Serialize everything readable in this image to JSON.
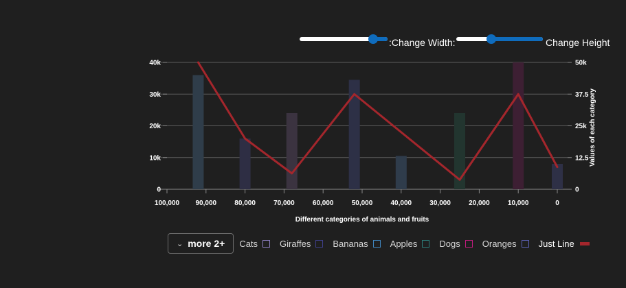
{
  "controls": {
    "width_label": ":Change Width:",
    "height_label": "Change Height"
  },
  "legend": {
    "overflow_label": "more 2+",
    "items": [
      {
        "label": "Cats",
        "color": "#8d7fc2"
      },
      {
        "label": "Giraffes",
        "color": "#3e3f8a"
      },
      {
        "label": "Bananas",
        "color": "#3f86bf"
      },
      {
        "label": "Apples",
        "color": "#2d7d7a"
      },
      {
        "label": "Dogs",
        "color": "#c01c7e"
      },
      {
        "label": "Oranges",
        "color": "#5c61b5"
      },
      {
        "label": "Just Line",
        "color": "#a4262c"
      }
    ]
  },
  "chart_data": {
    "type": "bar",
    "xlabel": "Different categories of animals and fruits",
    "ylabel": "",
    "y2label": "Values of each category",
    "x_reversed": true,
    "xlim": [
      0,
      100000
    ],
    "x_ticks": [
      "100,000",
      "90,000",
      "80,000",
      "70,000",
      "60,000",
      "50,000",
      "40,000",
      "30,000",
      "20,000",
      "10,000",
      "0"
    ],
    "ylim": [
      0,
      40000
    ],
    "y_ticks": [
      "0",
      "10k",
      "20k",
      "30k",
      "40k"
    ],
    "y2lim": [
      0,
      50000
    ],
    "y2_ticks": [
      "0",
      "12.5",
      "25k",
      "37.5",
      "50k"
    ],
    "grid": true,
    "bars": [
      {
        "x": 92000,
        "y": 36000,
        "color": "#2f3d4a"
      },
      {
        "x": 80000,
        "y": 16000,
        "color": "#2e2e44"
      },
      {
        "x": 68000,
        "y": 24000,
        "color": "#3b3340"
      },
      {
        "x": 52000,
        "y": 34500,
        "color": "#2d3046"
      },
      {
        "x": 40000,
        "y": 10500,
        "color": "#2f3c4b"
      },
      {
        "x": 25000,
        "y": 24000,
        "color": "#22352f"
      },
      {
        "x": 10000,
        "y": 40000,
        "color": "#3d1f33"
      },
      {
        "x": 0,
        "y": 8000,
        "color": "#2e3046"
      }
    ],
    "line": {
      "name": "Just Line",
      "color": "#a4262c",
      "points": [
        {
          "x": 92000,
          "y": 40000
        },
        {
          "x": 80000,
          "y": 16000
        },
        {
          "x": 68000,
          "y": 5000
        },
        {
          "x": 52000,
          "y": 30000
        },
        {
          "x": 25000,
          "y": 3000
        },
        {
          "x": 10000,
          "y": 30000
        },
        {
          "x": 0,
          "y": 7000
        }
      ]
    }
  }
}
